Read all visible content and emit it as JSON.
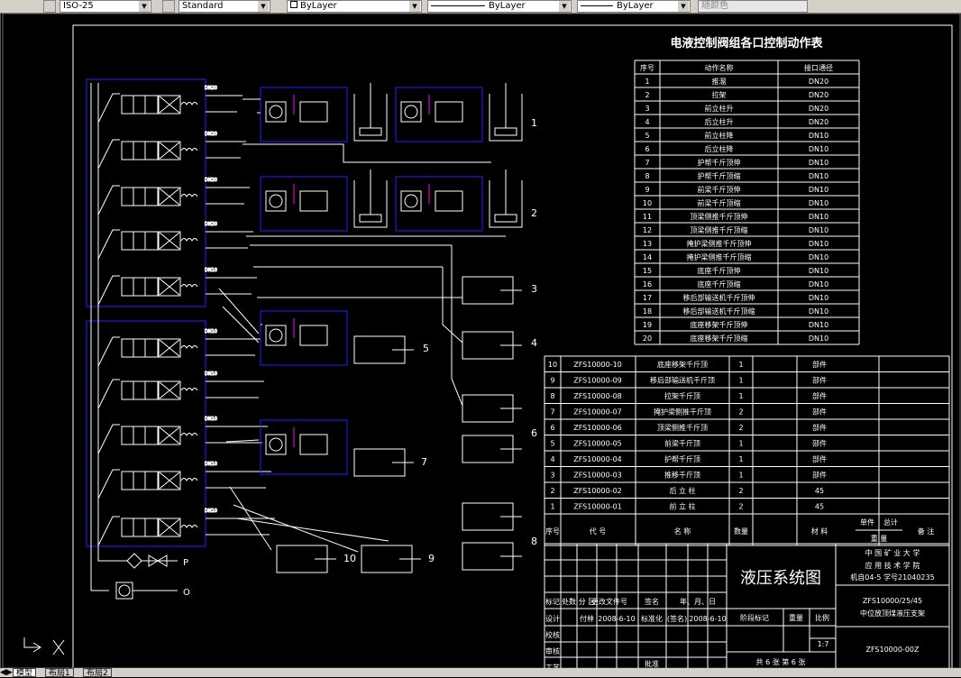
{
  "toolbar": {
    "dimstyle": "ISO-25",
    "textstyle": "Standard",
    "layer": "ByLayer",
    "linetype": "ByLayer",
    "lineweight": "ByLayer",
    "plotstyle": "随颜色"
  },
  "tabs": [
    "模型",
    "布局1",
    "布局2"
  ],
  "ctrl": {
    "title": "电液控制阀组各口控制动作表",
    "headers": [
      "序号",
      "动作名称",
      "接口通径"
    ],
    "rows": [
      [
        "1",
        "推溜",
        "DN20"
      ],
      [
        "2",
        "拉架",
        "DN20"
      ],
      [
        "3",
        "前立柱升",
        "DN20"
      ],
      [
        "4",
        "后立柱升",
        "DN20"
      ],
      [
        "5",
        "前立柱降",
        "DN10"
      ],
      [
        "6",
        "后立柱降",
        "DN10"
      ],
      [
        "7",
        "护帮千斤顶伸",
        "DN10"
      ],
      [
        "8",
        "护帮千斤顶缩",
        "DN10"
      ],
      [
        "9",
        "前梁千斤顶伸",
        "DN10"
      ],
      [
        "10",
        "前梁千斤顶缩",
        "DN10"
      ],
      [
        "11",
        "顶梁侧推千斤顶伸",
        "DN10"
      ],
      [
        "12",
        "顶梁侧推千斤顶缩",
        "DN10"
      ],
      [
        "13",
        "掩护梁侧推千斤顶伸",
        "DN10"
      ],
      [
        "14",
        "掩护梁侧推千斤顶缩",
        "DN10"
      ],
      [
        "15",
        "底座千斤顶伸",
        "DN10"
      ],
      [
        "16",
        "底座千斤顶缩",
        "DN10"
      ],
      [
        "17",
        "移后部输送机千斤顶伸",
        "DN10"
      ],
      [
        "18",
        "移后部输送机千斤顶缩",
        "DN10"
      ],
      [
        "19",
        "底座移架千斤顶伸",
        "DN10"
      ],
      [
        "20",
        "底座移架千斤顶缩",
        "DN10"
      ]
    ]
  },
  "bom": {
    "rows": [
      [
        "10",
        "ZFS10000-10",
        "底座移架千斤顶",
        "1",
        "部件"
      ],
      [
        "9",
        "ZFS10000-09",
        "移后部输送机千斤顶",
        "1",
        "部件"
      ],
      [
        "8",
        "ZFS10000-08",
        "拉架千斤顶",
        "1",
        "部件"
      ],
      [
        "7",
        "ZFS10000-07",
        "掩护梁侧推千斤顶",
        "2",
        "部件"
      ],
      [
        "6",
        "ZFS10000-06",
        "顶梁侧推千斤顶",
        "2",
        "部件"
      ],
      [
        "5",
        "ZFS10000-05",
        "前梁千斤顶",
        "1",
        "部件"
      ],
      [
        "4",
        "ZFS10000-04",
        "护帮千斤顶",
        "1",
        "部件"
      ],
      [
        "3",
        "ZFS10000-03",
        "推移千斤顶",
        "1",
        "部件"
      ],
      [
        "2",
        "ZFS10000-02",
        "后 立 柱",
        "2",
        "45"
      ],
      [
        "1",
        "ZFS10000-01",
        "前 立 柱",
        "2",
        "45"
      ]
    ],
    "headers": [
      "序号",
      "代 号",
      "名 称",
      "数量",
      "材 料",
      "单件",
      "总计",
      "备 注"
    ],
    "sub": "重 量"
  },
  "title": {
    "drawing": "液压系统图",
    "school": "中 国 矿 业 大 学",
    "dept": "应 用 技 术 学 院",
    "student": "机自04-5 学号21040235",
    "model": "ZFS10000/25/45",
    "product": "中位放顶煤液压支架",
    "code": "ZFS10000-00Z",
    "scale": "1:7",
    "sheets": "共 6 张 第 6 张",
    "rev": [
      "标记",
      "处数",
      "分 区",
      "更改文件号",
      "签名",
      "年、月、日"
    ],
    "design": [
      "设计",
      "付林",
      "2008-6-10",
      "标准化",
      "(签名)",
      "2008-6-10"
    ],
    "phase": [
      "阶段标记",
      "重量",
      "比例"
    ],
    "rows": [
      "校核",
      "审核",
      "工艺"
    ],
    "approve": "批准"
  },
  "labels": [
    "1",
    "2",
    "3",
    "4",
    "5",
    "6",
    "7",
    "8",
    "9",
    "10"
  ],
  "P": "P",
  "O": "O",
  "ports": [
    "DN20",
    "DN20",
    "DN20",
    "DN20",
    "DN10",
    "DN10",
    "DN10",
    "DN10",
    "DN10",
    "DN10"
  ]
}
